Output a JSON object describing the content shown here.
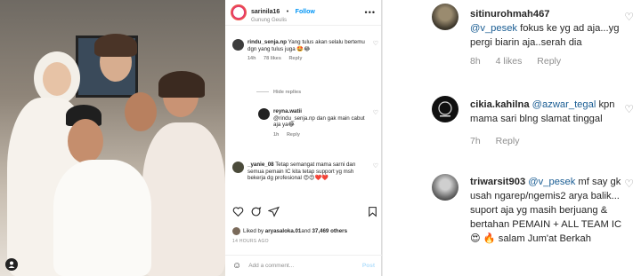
{
  "post": {
    "username": "sarinila16",
    "follow_label": "Follow",
    "location": "Gunung Geulis",
    "more_icon": "more-horizontal-icon",
    "comments": [
      {
        "user": "rindu_senja.np",
        "text": "Yang tulus akan selalu bertemu dgn yang tulus juga 🤩😂",
        "time": "14h",
        "likes": "78 likes",
        "reply": "Reply"
      },
      {
        "user": "reyna.watii",
        "text": "@rindu_senja.np dan gak main cabut aja ya😂",
        "time": "1h",
        "reply": "Reply"
      },
      {
        "user": "_yanie_08",
        "text": "Tetap semangat mama sarni dan semua pemain IC kita tetap support yg msh bekerja dg profesional 😍😍❤️❤️",
        "time": "",
        "reply": ""
      }
    ],
    "hide_replies": "Hide replies",
    "liked_by_prefix": "Liked by ",
    "liked_by_user": "aryasaloka.01",
    "liked_by_suffix": " and ",
    "liked_by_count": "37,469 others",
    "timestamp": "14 HOURS AGO",
    "add_comment_placeholder": "Add a comment...",
    "post_label": "Post"
  },
  "comments": [
    {
      "user": "sitinurohmah467",
      "mention": "@v_pesek",
      "text": " fokus ke yg ad aja...yg pergi biarin aja..serah dia",
      "time": "8h",
      "likes": "4 likes",
      "reply": "Reply"
    },
    {
      "user": "cikia.kahilna",
      "mention": "@azwar_tegal",
      "text": " kpn mama sari blng slamat tinggal",
      "time": "7h",
      "reply": "Reply"
    },
    {
      "user": "triwarsit903",
      "mention": "@v_pesek",
      "text": " mf say gk usah ngarep/ngemis2 arya balik... suport aja yg masih berjuang & bertahan PEMAIN + ALL TEAM IC 😍 🔥 salam Jum'at Berkah",
      "time": "",
      "reply": ""
    }
  ],
  "colors": {
    "accent": "#0095f6",
    "mention": "#1a5d93",
    "muted": "#8e8e8e"
  }
}
